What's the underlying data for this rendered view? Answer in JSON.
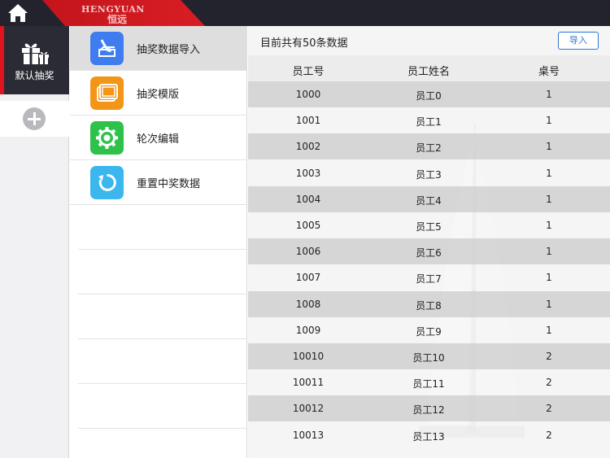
{
  "brand": {
    "en": "HENGYUAN",
    "cn": "恒远"
  },
  "rail": {
    "active_label": "默认抽奖"
  },
  "menu": {
    "items": [
      {
        "label": "抽奖数据导入",
        "color": "#3f7cf0",
        "icon": "import-icon"
      },
      {
        "label": "抽奖模版",
        "color": "#f39516",
        "icon": "template-icon"
      },
      {
        "label": "轮次编辑",
        "color": "#2ec24a",
        "icon": "gear-icon"
      },
      {
        "label": "重置中奖数据",
        "color": "#3bb7ee",
        "icon": "refresh-icon"
      }
    ]
  },
  "content": {
    "summary": "目前共有50条数据",
    "import_button": "导入",
    "columns": [
      "员工号",
      "员工姓名",
      "桌号"
    ],
    "rows": [
      [
        "1000",
        "员工0",
        "1"
      ],
      [
        "1001",
        "员工1",
        "1"
      ],
      [
        "1002",
        "员工2",
        "1"
      ],
      [
        "1003",
        "员工3",
        "1"
      ],
      [
        "1004",
        "员工4",
        "1"
      ],
      [
        "1005",
        "员工5",
        "1"
      ],
      [
        "1006",
        "员工6",
        "1"
      ],
      [
        "1007",
        "员工7",
        "1"
      ],
      [
        "1008",
        "员工8",
        "1"
      ],
      [
        "1009",
        "员工9",
        "1"
      ],
      [
        "10010",
        "员工10",
        "2"
      ],
      [
        "10011",
        "员工11",
        "2"
      ],
      [
        "10012",
        "员工12",
        "2"
      ],
      [
        "10013",
        "员工13",
        "2"
      ]
    ]
  },
  "colors": {
    "accent_red": "#e0141c",
    "link_blue": "#2f79d6",
    "dark": "#23232e"
  }
}
